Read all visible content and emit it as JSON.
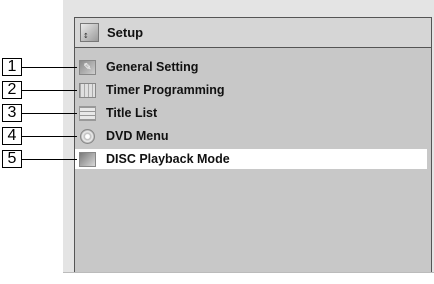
{
  "header": {
    "title": "Setup",
    "icon": "setup-icon"
  },
  "menu": {
    "items": [
      {
        "number": "1",
        "label": "General Setting",
        "icon": "wrench-icon"
      },
      {
        "number": "2",
        "label": "Timer Programming",
        "icon": "timer-grid-icon"
      },
      {
        "number": "3",
        "label": "Title List",
        "icon": "title-list-icon"
      },
      {
        "number": "4",
        "label": "DVD Menu",
        "icon": "dvd-disc-icon"
      },
      {
        "number": "5",
        "label": "DISC Playback Mode",
        "icon": "disc-playback-icon",
        "selected": true
      }
    ]
  },
  "colors": {
    "selected_background": "#ffffff",
    "panel_background": "#c8c8c8"
  }
}
